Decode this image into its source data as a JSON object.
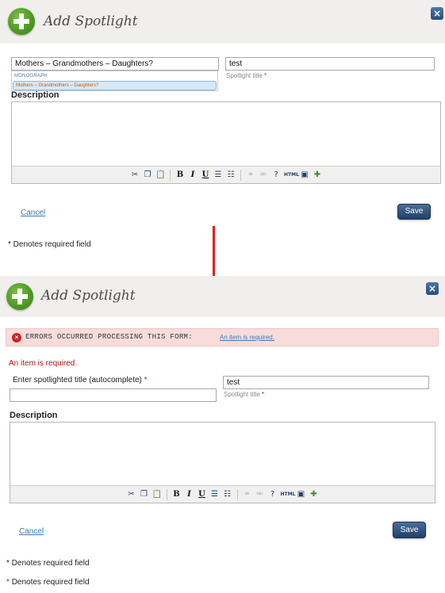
{
  "dialog1": {
    "title": "Add Spotlight",
    "close_icon": "×",
    "item_input_value": "Mothers – Grandmothers – Daughters?",
    "dropdown_group": "MONOGRAPH",
    "dropdown_option": "Mothers – Grandmothers – Daughters?",
    "spotlight_title_value": "test",
    "spotlight_title_hint": "Spotlight title",
    "required_mark": "*",
    "description_label": "Description",
    "cancel_label": "Cancel",
    "save_label": "Save",
    "required_note": "* Denotes required field"
  },
  "dialog2": {
    "title": "Add Spotlight",
    "close_icon": "×",
    "error_icon": "×",
    "error_title": "ERRORS OCCURRED PROCESSING THIS FORM:",
    "error_link": "An item is required.",
    "error_message": "An item is required.",
    "autocomplete_label": "Enter spotlighted title (autocomplete)",
    "required_mark": "*",
    "item_input_value": "",
    "spotlight_title_value": "test",
    "spotlight_title_hint": "Spotlight title",
    "description_label": "Description",
    "cancel_label": "Cancel",
    "save_label": "Save",
    "required_note_1": "* Denotes required field",
    "required_note_2_text": "Denotes required field"
  },
  "toolbar": {
    "cut": "✂",
    "copy": "❐",
    "paste": "📋",
    "bold": "B",
    "italic": "I",
    "underline": "U",
    "bullets": "☰",
    "numbers": "☷",
    "link": "⚭",
    "unlink": "⚮",
    "help": "?",
    "html": "HTML",
    "image": "▣",
    "insert": "✚"
  },
  "colors": {
    "accent_green": "#4f9a22",
    "close_blue": "#274d80",
    "error_red": "#b3161b",
    "arrow_red": "#ee1b1b",
    "link_blue": "#3a79b5"
  }
}
